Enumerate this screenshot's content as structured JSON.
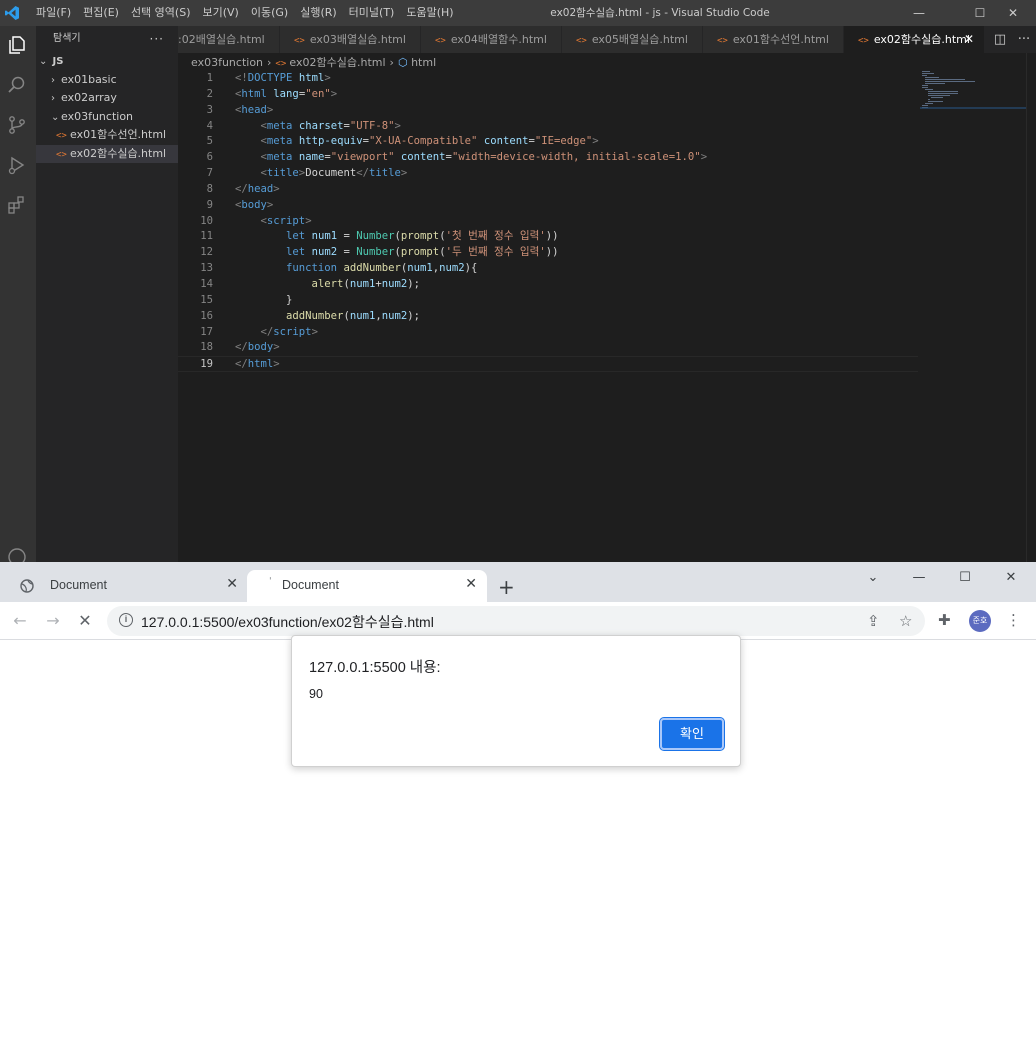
{
  "vscode": {
    "window_title": "ex02함수실습.html - js - Visual Studio Code",
    "menu": [
      "파일(F)",
      "편집(E)",
      "선택 영역(S)",
      "보기(V)",
      "이동(G)",
      "실행(R)",
      "터미널(T)",
      "도움말(H)"
    ],
    "explorer": {
      "title": "탐색기",
      "more": "···",
      "root": "JS",
      "items": [
        {
          "label": "ex01basic",
          "type": "folder-collapsed"
        },
        {
          "label": "ex02array",
          "type": "folder-collapsed"
        },
        {
          "label": "ex03function",
          "type": "folder-open"
        },
        {
          "label": "ex01함수선언.html",
          "type": "file"
        },
        {
          "label": "ex02함수실습.html",
          "type": "file",
          "selected": true
        }
      ]
    },
    "tabs": [
      {
        "label": ":02배열실습.html",
        "active": false
      },
      {
        "label": "ex03배열실습.html",
        "active": false
      },
      {
        "label": "ex04배열함수.html",
        "active": false
      },
      {
        "label": "ex05배열실습.html",
        "active": false
      },
      {
        "label": "ex01함수선언.html",
        "active": false
      },
      {
        "label": "ex02함수실습.html",
        "active": true
      }
    ],
    "tab_icon": "<>",
    "breadcrumb": [
      "ex03function",
      "ex02함수실습.html",
      "html"
    ],
    "active_line": 19
  },
  "browser": {
    "tabs": [
      {
        "title": "Document",
        "active": false
      },
      {
        "title": "Document",
        "active": true
      }
    ],
    "url": "127.0.0.1:5500/ex03function/ex02함수실습.html",
    "avatar_label": "준호",
    "dialog": {
      "title": "127.0.0.1:5500 내용:",
      "message": "90",
      "ok_label": "확인"
    }
  },
  "colors": {
    "vscode_bg": "#1e1e1e",
    "accent_blue": "#1a73e8",
    "html_icon": "#e37933"
  }
}
